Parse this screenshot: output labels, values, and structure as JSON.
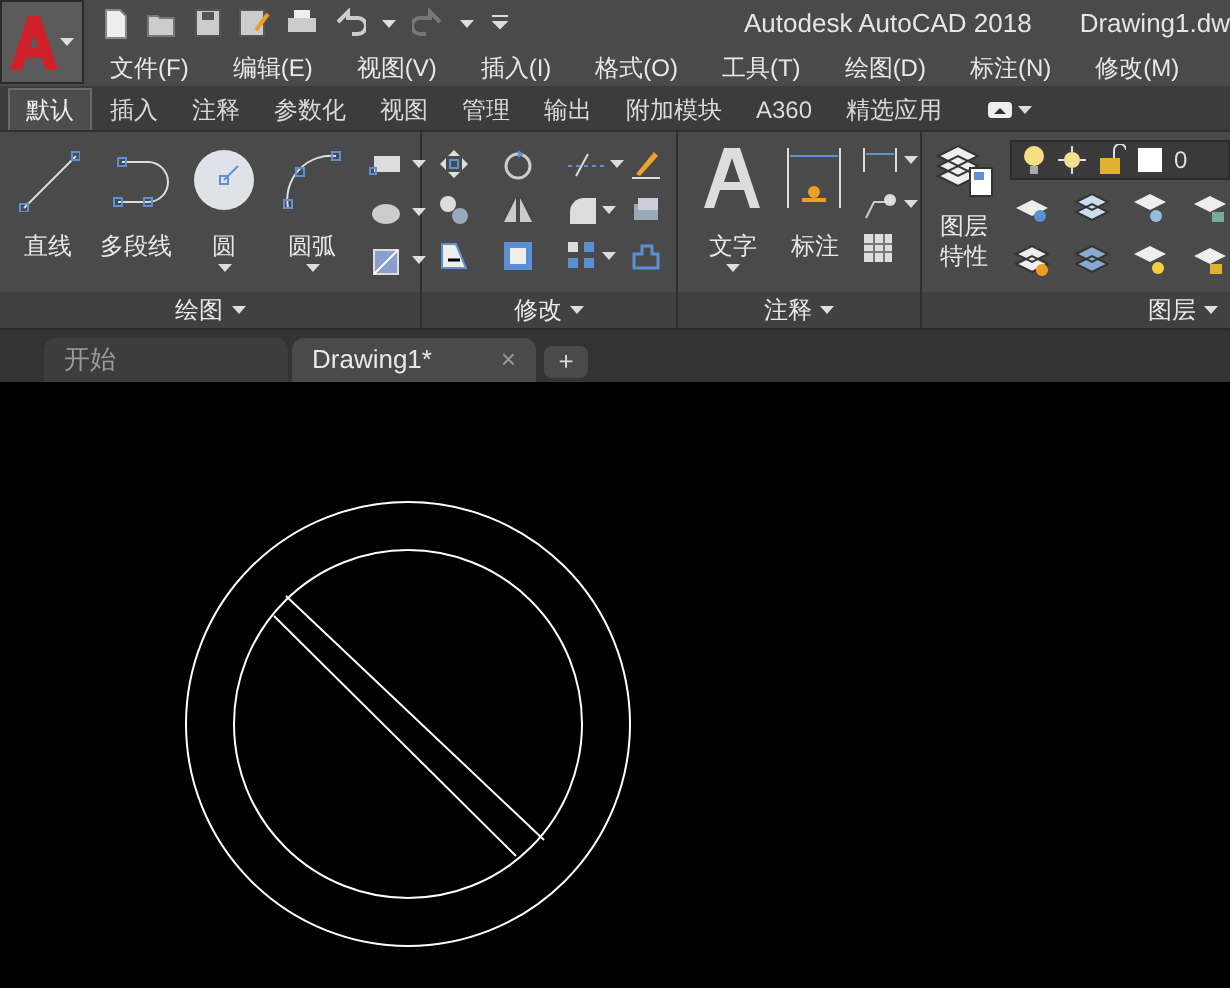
{
  "title_bar": {
    "title": "Autodesk AutoCAD 2018",
    "document": "Drawing1.dw"
  },
  "menu_bar": {
    "items": [
      "文件(F)",
      "编辑(E)",
      "视图(V)",
      "插入(I)",
      "格式(O)",
      "工具(T)",
      "绘图(D)",
      "标注(N)",
      "修改(M)"
    ]
  },
  "ribbon_tabs": [
    {
      "label": "默认",
      "selected": true
    },
    {
      "label": "插入",
      "selected": false
    },
    {
      "label": "注释",
      "selected": false
    },
    {
      "label": "参数化",
      "selected": false
    },
    {
      "label": "视图",
      "selected": false
    },
    {
      "label": "管理",
      "selected": false
    },
    {
      "label": "输出",
      "selected": false
    },
    {
      "label": "附加模块",
      "selected": false
    },
    {
      "label": "A360",
      "selected": false
    },
    {
      "label": "精选应用",
      "selected": false
    }
  ],
  "panels": {
    "draw": {
      "title": "绘图",
      "tools": [
        "直线",
        "多段线",
        "圆",
        "圆弧"
      ]
    },
    "modify": {
      "title": "修改"
    },
    "annotation": {
      "title": "注释",
      "tools": [
        "文字",
        "标注"
      ]
    },
    "layers": {
      "title": "图层",
      "tool": "图层特性",
      "current_layer": "0"
    }
  },
  "file_tabs": [
    {
      "label": "开始",
      "selected": false
    },
    {
      "label": "Drawing1*",
      "selected": true,
      "close": "×"
    }
  ],
  "new_tab": "+"
}
